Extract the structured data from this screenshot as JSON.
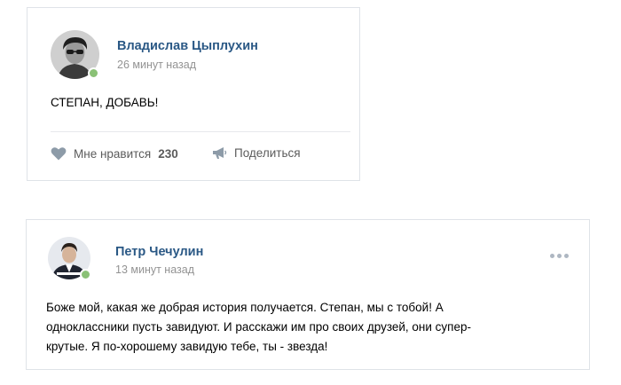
{
  "posts": [
    {
      "author": "Владислав Цыплухин",
      "time": "26 минут назад",
      "text": "СТЕПАН, ДОБАВЬ!",
      "like_label": "Мне нравится",
      "like_count": "230",
      "share_label": "Поделиться"
    },
    {
      "author": "Петр Чечулин",
      "time": "13 минут назад",
      "text_lines": [
        "Боже мой, какая же добрая история получается. Степан, мы с тобой! А",
        "одноклассники пусть завидуют. И расскажи им про своих друзей, они супер-",
        "крутые. Я по-хорошему завидую тебе, ты - звезда!"
      ]
    }
  ],
  "colors": {
    "author_link": "#2a5885",
    "time_gray": "#939393",
    "online_dot": "#8ac176",
    "icon_gray": "#8d9ba8",
    "border": "#dfe3e8"
  },
  "icons": {
    "like": "heart-icon",
    "share": "megaphone-icon",
    "more": "more-dots-icon",
    "online": "online-indicator"
  }
}
